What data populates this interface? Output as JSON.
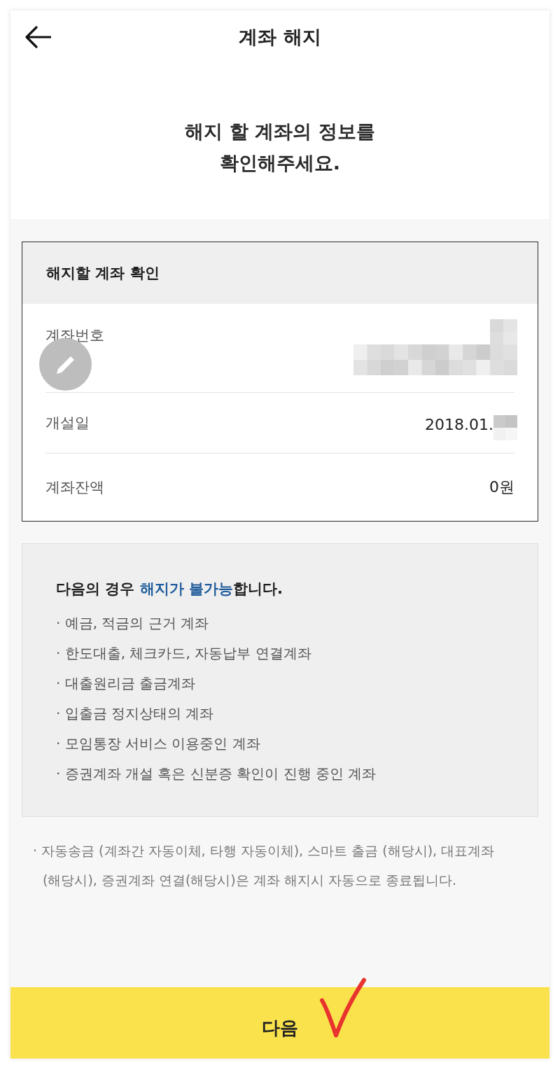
{
  "header": {
    "title": "계좌 해지"
  },
  "intro": {
    "text": "해지 할 계좌의 정보를\n확인해주세요."
  },
  "account_card": {
    "title": "해지할 계좌 확인",
    "rows": [
      {
        "kind": "masked",
        "label": "계좌번호"
      },
      {
        "kind": "partial",
        "label": "개설일",
        "value": "2018.01."
      },
      {
        "kind": "text",
        "label": "계좌잔액",
        "value": "0원"
      }
    ]
  },
  "notice": {
    "heading": [
      {
        "text": "다음의 경우 ",
        "highlight": false
      },
      {
        "text": "해지가 불가능",
        "highlight": true
      },
      {
        "text": "합니다.",
        "highlight": false
      }
    ],
    "items": [
      "· 예금, 적금의 근거 계좌",
      "· 한도대출, 체크카드, 자동납부 연결계좌",
      "· 대출원리금 출금계좌",
      "· 입출금 정지상태의 계좌",
      "· 모임통장 서비스 이용중인 계좌",
      "· 증권계좌 개설 혹은 신분증 확인이 진행 중인 계좌"
    ]
  },
  "footnote": "· 자동송금 (계좌간 자동이체, 타행 자동이체), 스마트 출금 (해당시), 대표계좌 (해당시), 증권계좌 연결(해당시)은 계좌 해지시 자동으로 종료됩니다.",
  "next_button": {
    "label": "다음"
  }
}
